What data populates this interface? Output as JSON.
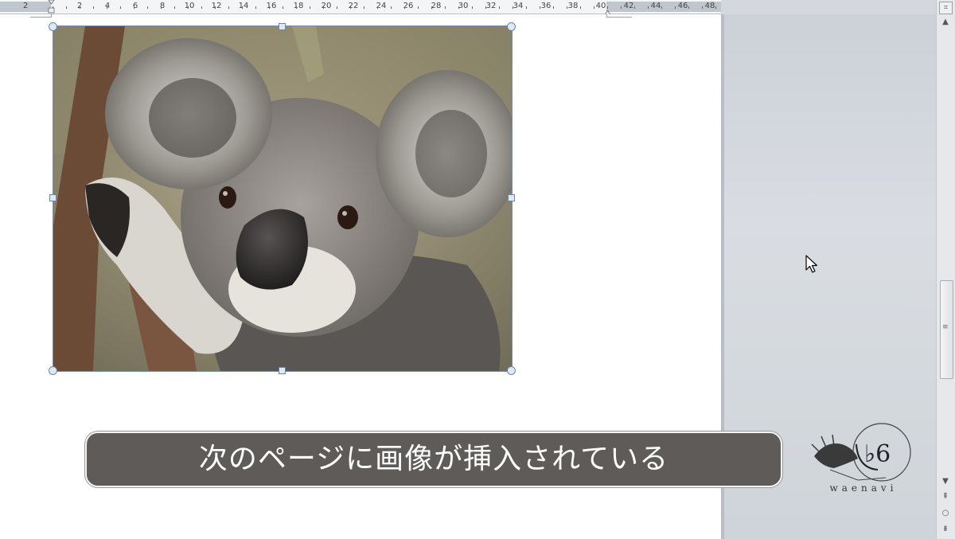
{
  "ruler": {
    "labels": [
      "2",
      "2",
      "4",
      "6",
      "8",
      "10",
      "12",
      "14",
      "16",
      "18",
      "20",
      "22",
      "24",
      "26",
      "28",
      "30",
      "32",
      "34",
      "36",
      "38",
      "40",
      "42",
      "44",
      "46",
      "48"
    ]
  },
  "document": {
    "image": {
      "subject": "koala-photo",
      "selected": true
    }
  },
  "caption": {
    "text": "次のページに画像が挿入されている"
  },
  "logo": {
    "text": "waenavi"
  },
  "scrollbar": {
    "up": "▲",
    "down": "▼",
    "prev_page": "⇞",
    "select_browse": "○",
    "next_page": "⇟",
    "grip": "≡"
  },
  "colors": {
    "caption_bg": "#5f5b59",
    "workspace_bg": "#d4d8dd",
    "page_bg": "#ffffff",
    "handle_border": "#6b86a6"
  }
}
